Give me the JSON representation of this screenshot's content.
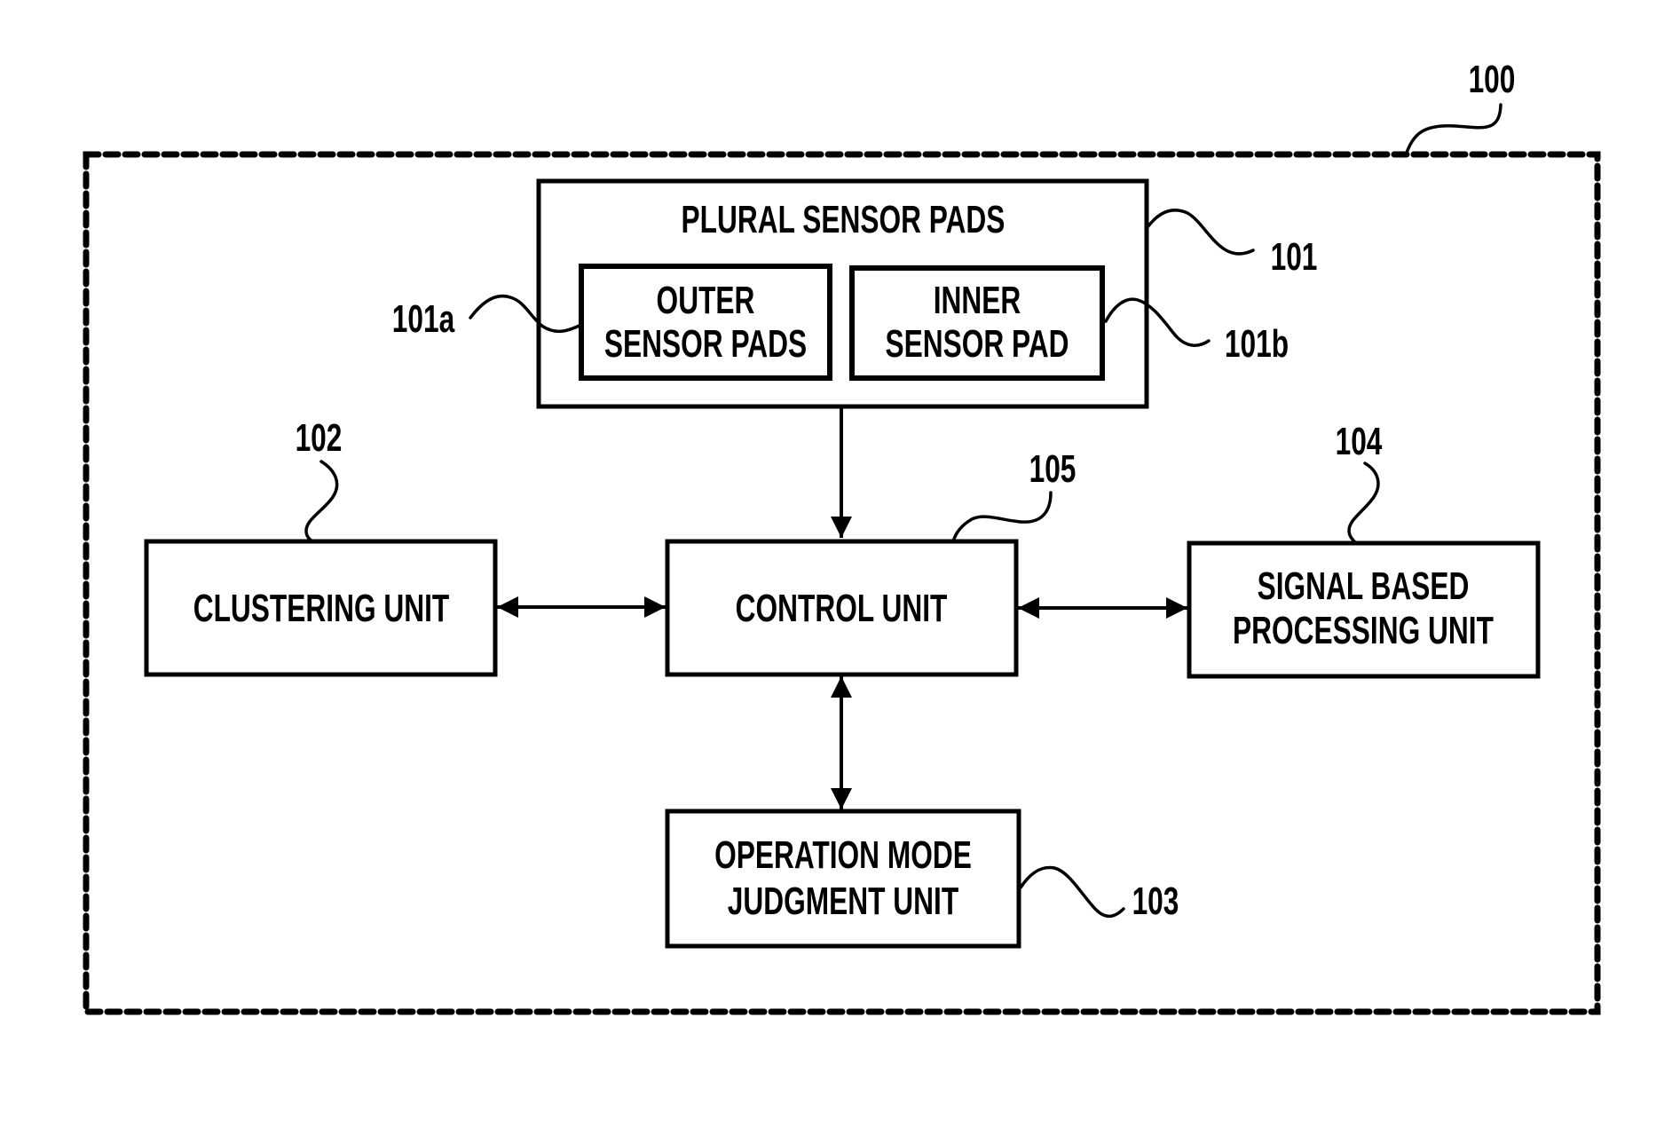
{
  "figure": {
    "system": {
      "ref": "100"
    },
    "blocks": {
      "plural_sensor_pads": {
        "ref": "101",
        "lines": [
          "PLURAL SENSOR PADS"
        ]
      },
      "outer_sensor_pads": {
        "ref": "101a",
        "lines": [
          "OUTER",
          "SENSOR PADS"
        ]
      },
      "inner_sensor_pad": {
        "ref": "101b",
        "lines": [
          "INNER",
          "SENSOR PAD"
        ]
      },
      "clustering_unit": {
        "ref": "102",
        "lines": [
          "CLUSTERING UNIT"
        ]
      },
      "operation_mode_judgment_unit": {
        "ref": "103",
        "lines": [
          "OPERATION MODE",
          "JUDGMENT UNIT"
        ]
      },
      "signal_based_processing_unit": {
        "ref": "104",
        "lines": [
          "SIGNAL BASED",
          "PROCESSING UNIT"
        ]
      },
      "control_unit": {
        "ref": "105",
        "lines": [
          "CONTROL UNIT"
        ]
      }
    },
    "connections": [
      {
        "from": "plural_sensor_pads",
        "to": "control_unit",
        "type": "one-way"
      },
      {
        "from": "clustering_unit",
        "to": "control_unit",
        "type": "two-way"
      },
      {
        "from": "control_unit",
        "to": "signal_based_processing_unit",
        "type": "two-way"
      },
      {
        "from": "control_unit",
        "to": "operation_mode_judgment_unit",
        "type": "two-way"
      }
    ]
  }
}
